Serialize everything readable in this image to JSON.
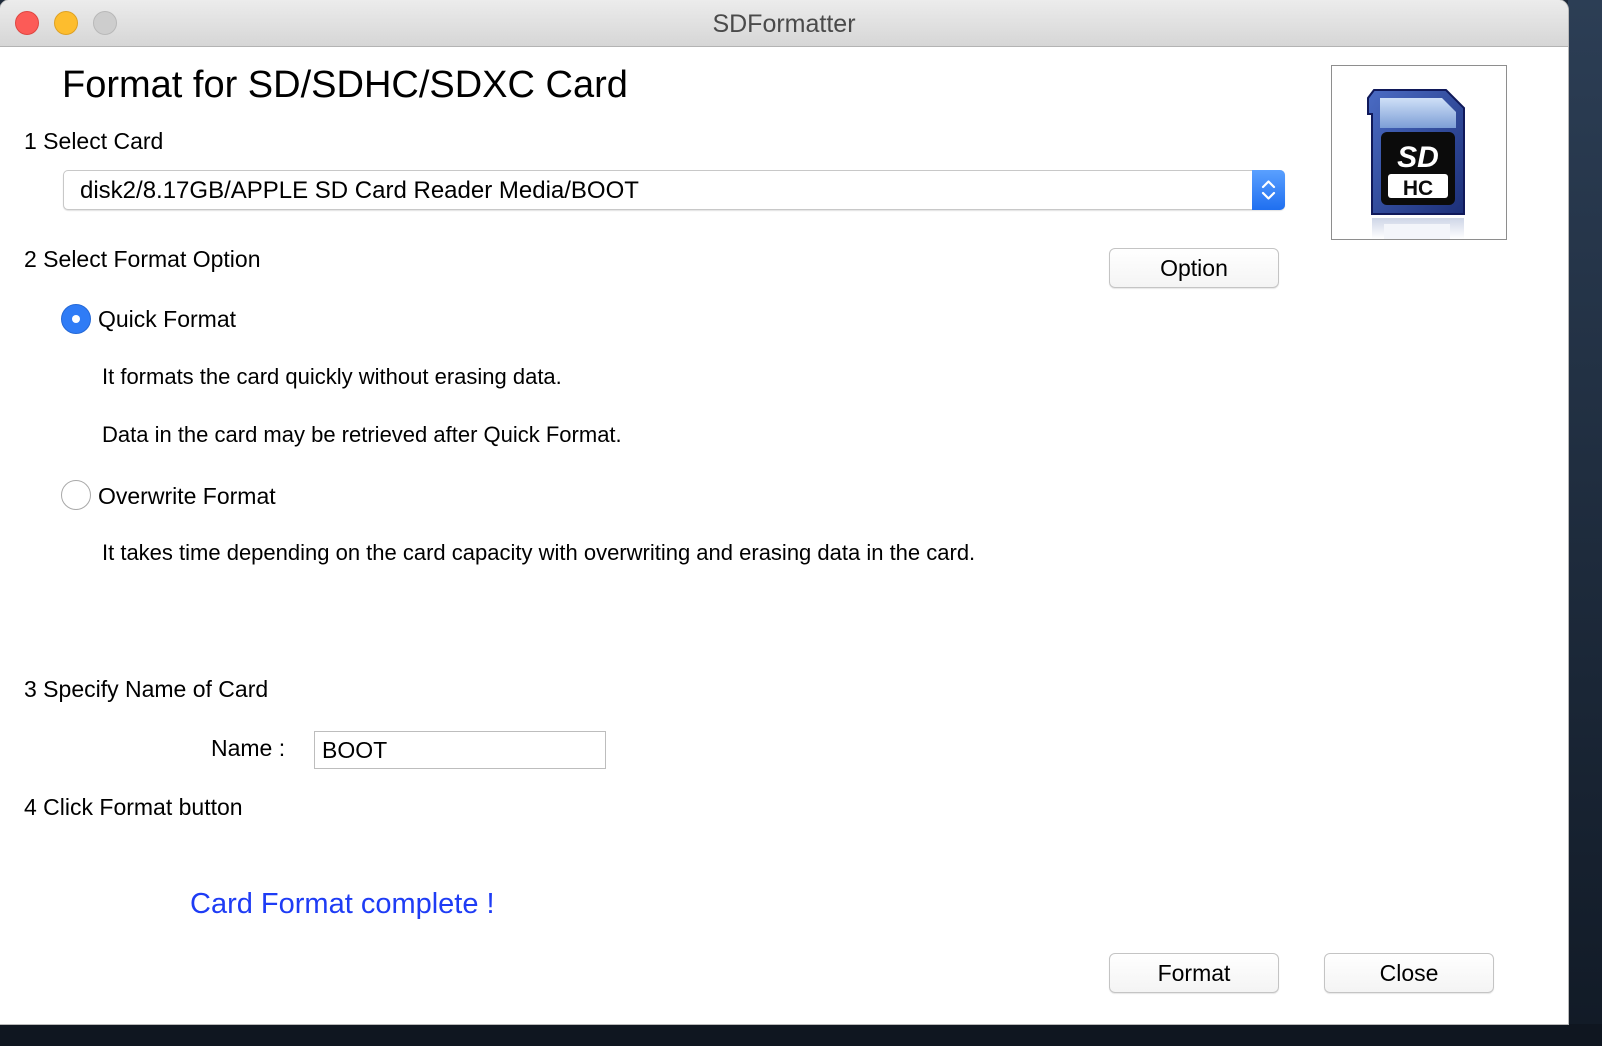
{
  "window": {
    "title": "SDFormatter"
  },
  "heading": "Format for SD/SDHC/SDXC Card",
  "steps": {
    "select_card": "1 Select Card",
    "format_option": "2 Select Format Option",
    "card_name": "3 Specify Name of Card",
    "click_format": "4 Click Format button"
  },
  "card_select": {
    "value": "disk2/8.17GB/APPLE SD Card Reader Media/BOOT"
  },
  "card_image": {
    "logo_text": "SD HC"
  },
  "option_button": "Option",
  "format_options": [
    {
      "label": "Quick Format",
      "selected": true,
      "descriptions": [
        "It formats the card quickly without erasing data.",
        "Data in the card may be retrieved after Quick Format."
      ]
    },
    {
      "label": "Overwrite Format",
      "selected": false,
      "descriptions": [
        "It takes time depending on the card capacity with overwriting and erasing data in the card."
      ]
    }
  ],
  "name_field": {
    "label": "Name :",
    "value": "BOOT"
  },
  "status_message": "Card Format complete !",
  "buttons": {
    "format": "Format",
    "close": "Close"
  },
  "colors": {
    "accent": "#2f7cf6",
    "status_text": "#1e3cf5",
    "close_light": "#fc5b57",
    "minimize_light": "#fdbd2e",
    "zoom_light": "#cdcdcd"
  }
}
